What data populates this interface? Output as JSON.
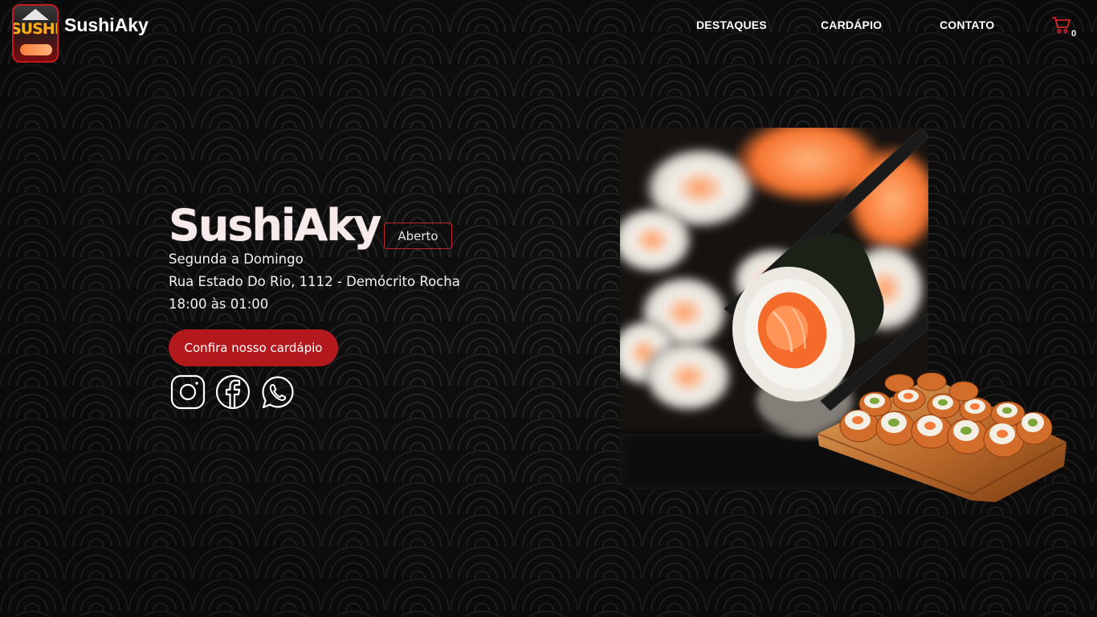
{
  "header": {
    "brand": "SushiAky",
    "logo_text": "SUSHI",
    "nav": [
      "DESTAQUES",
      "CARDÁPIO",
      "CONTATO"
    ],
    "cart_count": "0",
    "cart_icon": "cart-icon"
  },
  "hero": {
    "title": "SushiAky",
    "status": "Aberto",
    "days": "Segunda a Domingo",
    "address": "Rua Estado Do Rio, 1112 - Demócrito Rocha",
    "hours": "18:00 às 01:00",
    "cta_label": "Confira nosso cardápio",
    "social_icons": [
      "instagram-icon",
      "facebook-icon",
      "whatsapp-icon"
    ]
  },
  "colors": {
    "accent": "#b3181d",
    "background": "#101010",
    "text": "#ffffff"
  }
}
